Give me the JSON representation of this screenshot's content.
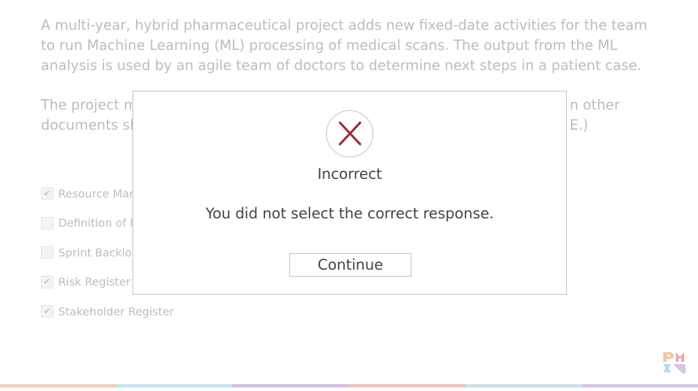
{
  "question": {
    "paragraph1": "A multi-year, hybrid pharmaceutical project adds new fixed-date activities for the team to run Machine Learning (ML) processing of medical scans. The output from the ML analysis is used by an agile team of doctors to determine next steps in a patient case.",
    "paragraph2_start": "The project m",
    "paragraph2_end_line1": "n other",
    "paragraph2_line2_start": "documents sh",
    "paragraph2_line2_end": "E.)"
  },
  "options": [
    {
      "label": "Resource Mar",
      "checked": true
    },
    {
      "label": "Definition of F",
      "checked": false
    },
    {
      "label": "Sprint Backlog",
      "checked": false
    },
    {
      "label": "Risk Register",
      "checked": true
    },
    {
      "label": "Stakeholder Register",
      "checked": true
    }
  ],
  "modal": {
    "icon": "x-icon",
    "title": "Incorrect",
    "message": "You did not select the correct response.",
    "continue_label": "Continue"
  },
  "colors": {
    "error_red": "#9b2a35",
    "progress": [
      "#f6d0b8",
      "#c7e6ef",
      "#d3c3e6",
      "#f2c2bf",
      "#cfe0e6",
      "#d5c6e8"
    ]
  },
  "logo": {
    "text": "PMI",
    "icon": "pmi-logo-icon"
  }
}
